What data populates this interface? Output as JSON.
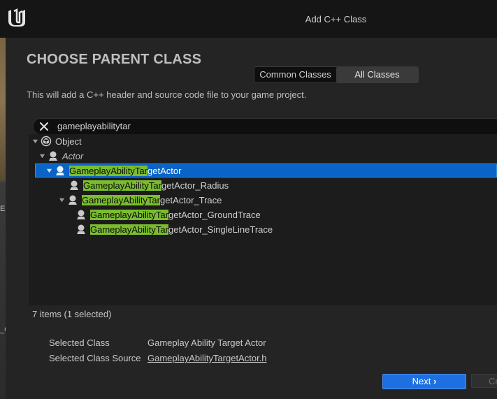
{
  "window": {
    "title": "Add C++ Class"
  },
  "header": {
    "heading": "CHOOSE PARENT CLASS",
    "tabs": [
      {
        "label": "Common Classes",
        "active": false
      },
      {
        "label": "All Classes",
        "active": true
      }
    ],
    "description": "This will add a C++ header and source code file to your game project."
  },
  "search": {
    "value": "gameplayabilitytar"
  },
  "tree": {
    "rows": [
      {
        "label": "Object",
        "match": "",
        "rest": "Object",
        "icon": "object-icon",
        "expanded": true,
        "italic": false,
        "selected": false
      },
      {
        "label": "Actor",
        "match": "",
        "rest": "Actor",
        "icon": "actor-icon",
        "expanded": true,
        "italic": true,
        "selected": false
      },
      {
        "label": "GameplayAbilityTargetActor",
        "match": "GameplayAbilityTar",
        "rest": "getActor",
        "icon": "actor-icon",
        "expanded": true,
        "italic": false,
        "selected": true
      },
      {
        "label": "GameplayAbilityTargetActor_Radius",
        "match": "GameplayAbilityTar",
        "rest": "getActor_Radius",
        "icon": "actor-icon",
        "expanded": false,
        "italic": false,
        "selected": false
      },
      {
        "label": "GameplayAbilityTargetActor_Trace",
        "match": "GameplayAbilityTar",
        "rest": "getActor_Trace",
        "icon": "actor-icon",
        "expanded": true,
        "italic": false,
        "selected": false
      },
      {
        "label": "GameplayAbilityTargetActor_GroundTrace",
        "match": "GameplayAbilityTar",
        "rest": "getActor_GroundTrace",
        "icon": "actor-icon",
        "expanded": false,
        "italic": false,
        "selected": false
      },
      {
        "label": "GameplayAbilityTargetActor_SingleLineTrace",
        "match": "GameplayAbilityTar",
        "rest": "getActor_SingleLineTrace",
        "icon": "actor-icon",
        "expanded": false,
        "italic": false,
        "selected": false
      }
    ]
  },
  "status": {
    "item_count": "7 items (1 selected)"
  },
  "selection": {
    "class_label": "Selected Class",
    "class_value": "Gameplay Ability Target Actor",
    "source_label": "Selected Class Source",
    "source_value": "GameplayAbilityTargetActor.h"
  },
  "buttons": {
    "next_label": "Next",
    "cancel_label": "Cr"
  },
  "background": {
    "edge_labels": [
      "E",
      "_C"
    ]
  },
  "colors": {
    "accent": "#0a64c8",
    "match_highlight": "#7bbd2e",
    "primary_button": "#1e6fe0"
  }
}
